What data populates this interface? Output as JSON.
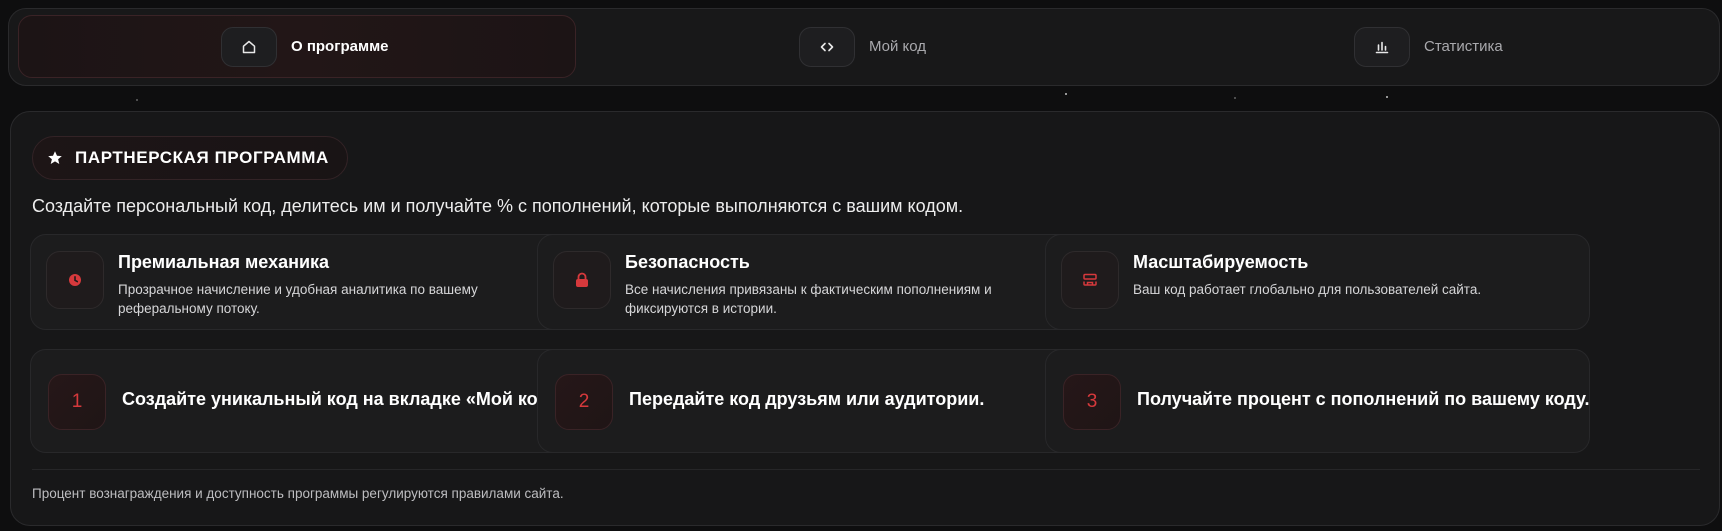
{
  "tabs": [
    {
      "label": "О программе",
      "icon": "home-icon",
      "active": true
    },
    {
      "label": "Мой код",
      "icon": "code-icon",
      "active": false
    },
    {
      "label": "Статистика",
      "icon": "bar-chart-icon",
      "active": false
    }
  ],
  "card": {
    "badge": {
      "label": "ПАРТНЕРСКАЯ ПРОГРАММА",
      "icon": "star-icon"
    },
    "intro": "Создайте персональный код, делитесь им и получайте % с пополнений, которые выполняются с вашим кодом.",
    "features": [
      {
        "title": "Премиальная механика",
        "desc": "Прозрачное начисление и удобная аналитика по вашему реферальному потоку.",
        "icon": "clock-icon"
      },
      {
        "title": "Безопасность",
        "desc": "Все начисления привязаны к фактическим пополнениям и фиксируются в истории.",
        "icon": "lock-icon"
      },
      {
        "title": "Масштабируемость",
        "desc": "Ваш код работает глобально для пользователей сайта.",
        "icon": "scale-icon"
      }
    ],
    "steps": [
      {
        "num": "1",
        "text": "Создайте уникальный код на вкладке «Мой код»."
      },
      {
        "num": "2",
        "text": "Передайте код друзьям или аудитории."
      },
      {
        "num": "3",
        "text": "Получайте процент с пополнений по вашему коду."
      }
    ],
    "footnote": "Процент вознаграждения и доступность программы регулируются правилами сайта."
  },
  "colors": {
    "accent": "#d6393c",
    "background": "#0e0e0f",
    "card": "#171718"
  }
}
